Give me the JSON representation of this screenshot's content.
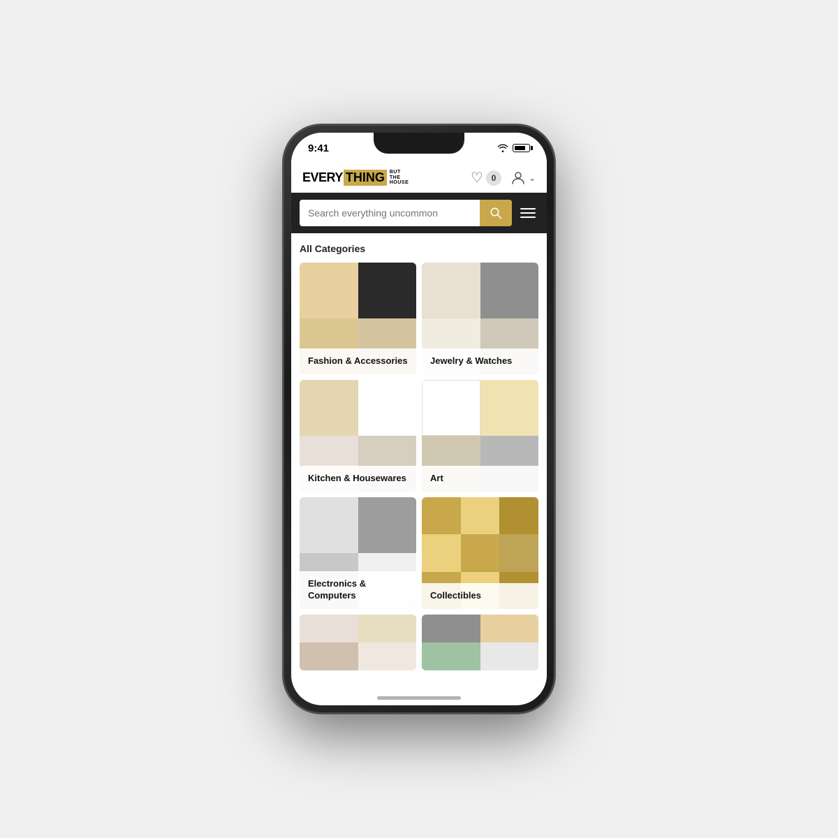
{
  "phone": {
    "time": "9:41",
    "signal_icon": "wifi",
    "battery_icon": "battery"
  },
  "header": {
    "logo_every": "EVERY",
    "logo_thing": "THING",
    "logo_but": "BUT",
    "logo_the": "THE",
    "logo_house": "HOUSE",
    "favorites_count": "0",
    "account_label": "account"
  },
  "search": {
    "placeholder": "Search everything uncommon",
    "search_button_label": "search"
  },
  "menu": {
    "menu_button_label": "menu"
  },
  "categories_section": {
    "title": "All Categories",
    "categories": [
      {
        "id": "fashion",
        "label": "Fashion & Accessories"
      },
      {
        "id": "jewelry",
        "label": "Jewelry & Watches"
      },
      {
        "id": "kitchen",
        "label": "Kitchen & Housewares"
      },
      {
        "id": "art",
        "label": "Art"
      },
      {
        "id": "electronics",
        "label": "Electronics & Computers"
      },
      {
        "id": "collectibles",
        "label": "Collectibles"
      }
    ]
  },
  "colors": {
    "gold": "#c8a84b",
    "dark": "#222222",
    "white": "#ffffff"
  }
}
